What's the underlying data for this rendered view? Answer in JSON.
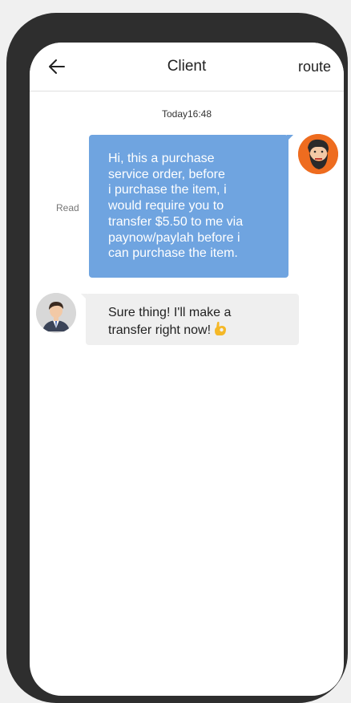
{
  "header": {
    "back_icon": "arrow-left-icon",
    "title": "Client",
    "action_label": "route"
  },
  "chat": {
    "timestamp": "Today16:48",
    "messages": [
      {
        "direction": "outgoing",
        "avatar": "bearded-man-avatar",
        "status": "Read",
        "lines": [
          "Hi, this a purchase",
          "service order, before",
          "i purchase the item, i",
          "would require you to",
          "transfer $5.50 to me via",
          "paynow/paylah before i",
          "can purchase the item."
        ],
        "bubble_color": "#6fa4e0"
      },
      {
        "direction": "incoming",
        "avatar": "businessman-avatar",
        "lines": [
          "Sure thing! I'll make a",
          "transfer right now!"
        ],
        "emoji": "ok-hand-emoji",
        "bubble_color": "#efefef"
      }
    ]
  },
  "colors": {
    "phone_frame": "#2e2e2e",
    "background": "#f0f0f0",
    "avatar_accent": "#ee6c1f"
  }
}
